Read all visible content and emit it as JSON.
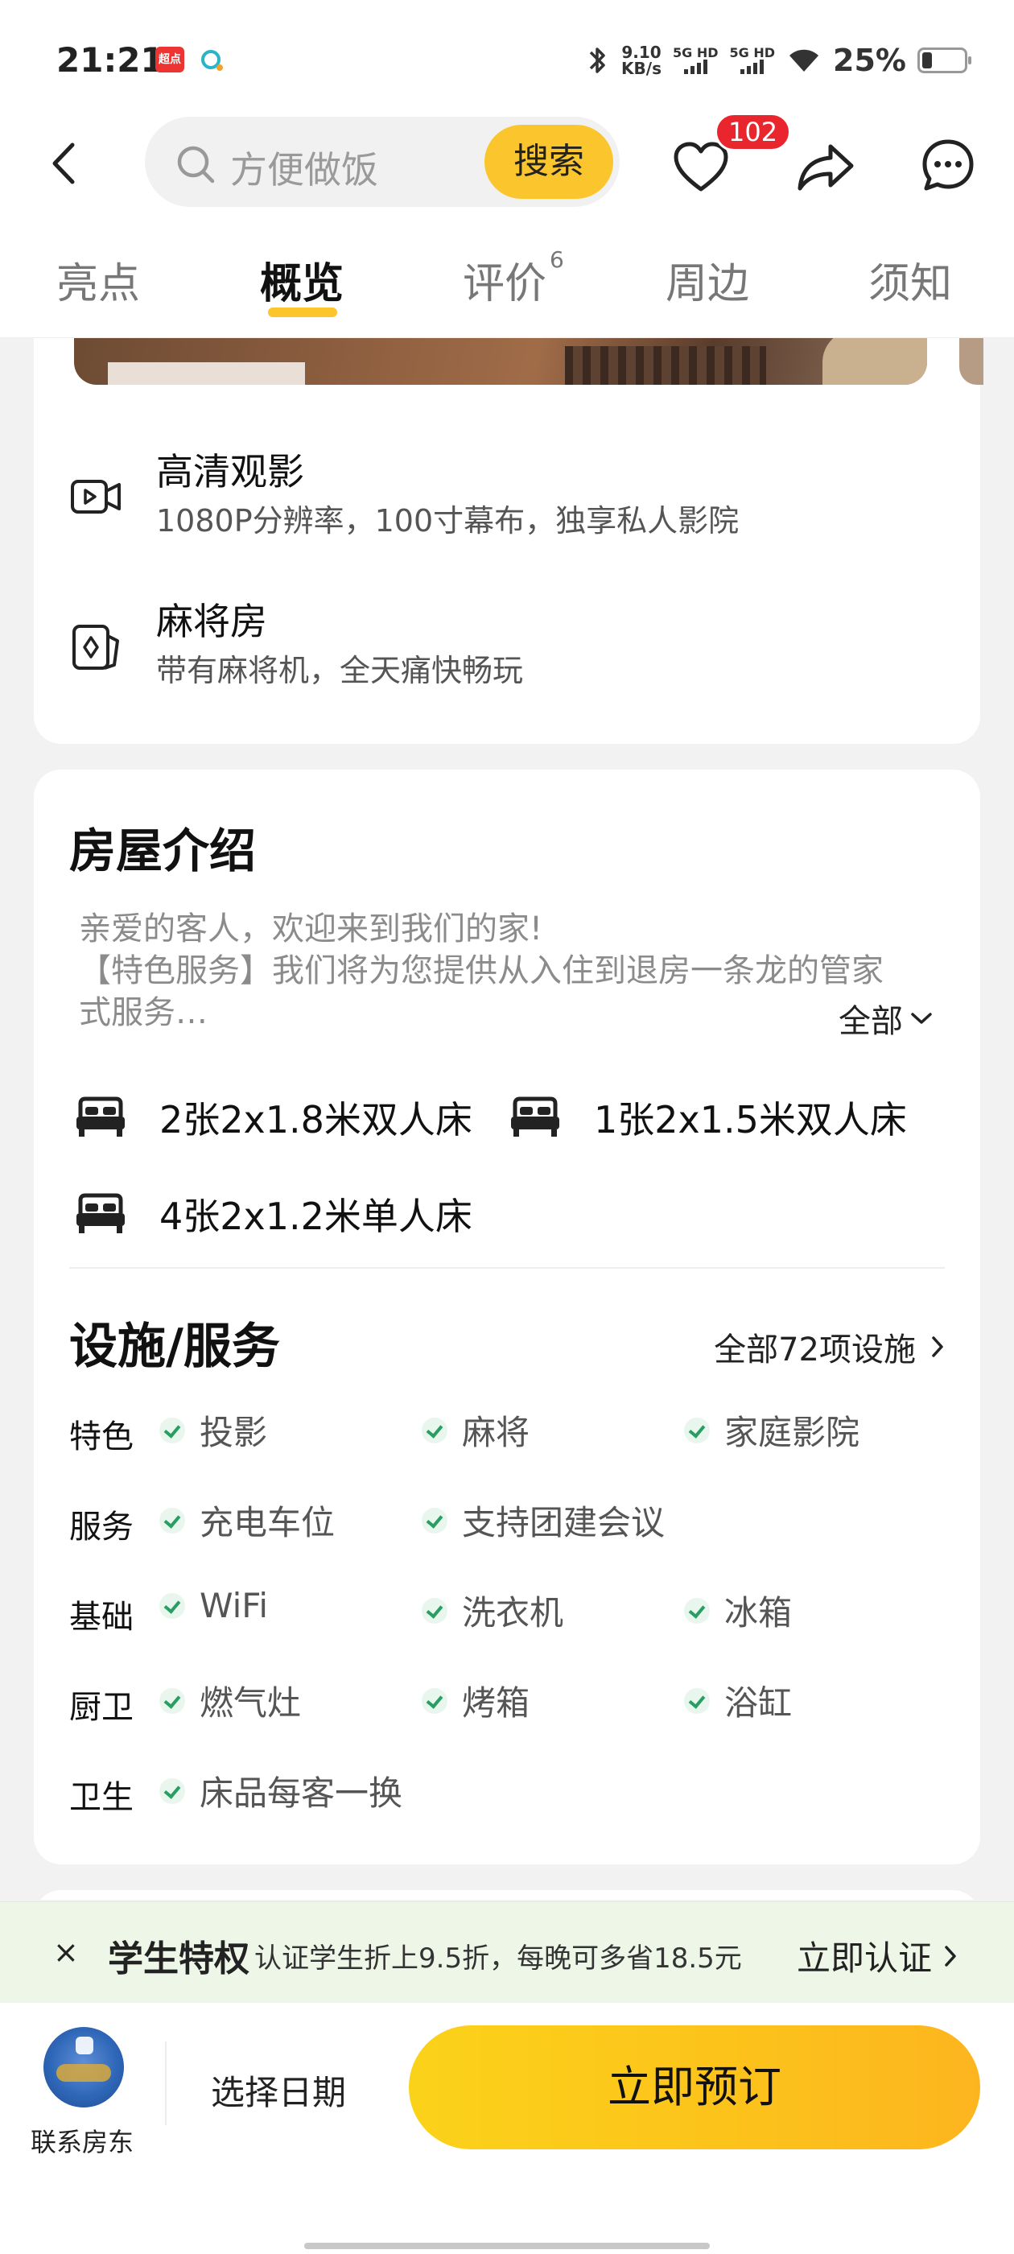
{
  "status_bar": {
    "time": "21:21",
    "app1_label": "超点",
    "speed_value": "9.10",
    "speed_unit": "KB/s",
    "sig1": "5G HD",
    "sig2": "5G HD",
    "battery": "25%"
  },
  "nav": {
    "search_placeholder": "方便做饭",
    "search_button": "搜索",
    "fav_count": "102"
  },
  "tabs": [
    {
      "label": "亮点"
    },
    {
      "label": "概览"
    },
    {
      "label": "评价",
      "count": "6"
    },
    {
      "label": "周边"
    },
    {
      "label": "须知"
    }
  ],
  "highlights": [
    {
      "title": "高清观影",
      "desc": "1080P分辨率，100寸幕布，独享私人影院",
      "icon": "video-icon"
    },
    {
      "title": "麻将房",
      "desc": "带有麻将机，全天痛快畅玩",
      "icon": "mahjong-icon"
    }
  ],
  "intro": {
    "title": "房屋介绍",
    "line1": "亲爱的客人，欢迎来到我们的家!",
    "line2": "【特色服务】我们将为您提供从入住到退房一条龙的管家",
    "line3": "式服务…",
    "more": "全部"
  },
  "beds": [
    {
      "text": "2张2x1.8米双人床"
    },
    {
      "text": "1张2x1.5米双人床"
    },
    {
      "text": "4张2x1.2米单人床"
    }
  ],
  "facilities": {
    "title": "设施/服务",
    "all_label": "全部72项设施",
    "rows": [
      {
        "label": "特色",
        "items": [
          "投影",
          "麻将",
          "家庭影院"
        ]
      },
      {
        "label": "服务",
        "items": [
          "充电车位",
          "支持团建会议"
        ]
      },
      {
        "label": "基础",
        "items": [
          "WiFi",
          "洗衣机",
          "冰箱"
        ]
      },
      {
        "label": "厨卫",
        "items": [
          "燃气灶",
          "烤箱",
          "浴缸"
        ]
      },
      {
        "label": "卫生",
        "items": [
          "床品每客一换"
        ]
      }
    ]
  },
  "promo": {
    "close": "×",
    "title": "学生特权",
    "text": "认证学生折上9.5折，每晚可多省18.5元",
    "cta": "立即认证"
  },
  "bottom": {
    "contact": "联系房东",
    "date": "选择日期",
    "book": "立即预订"
  },
  "colors": {
    "accent": "#fbc52e",
    "badge": "#e9262e",
    "check": "#2a9d63"
  }
}
